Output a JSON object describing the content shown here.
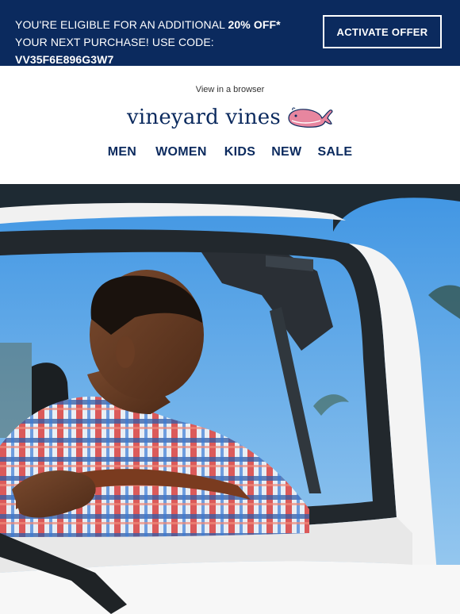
{
  "promo": {
    "text_before": "YOU'RE ELIGIBLE FOR AN ADDITIONAL ",
    "discount": "20% OFF*",
    "text_middle": " YOUR NEXT PURCHASE! USE CODE: ",
    "code": "VV35F6E896G3W7",
    "button_label": "ACTIVATE OFFER"
  },
  "header": {
    "view_in_browser": "View in a browser",
    "brand_logo_text": "vineyard vines",
    "nav": [
      "MEN",
      "WOMEN",
      "KIDS",
      "NEW",
      "SALE"
    ]
  },
  "colors": {
    "navy": "#0b2a5e",
    "whale_pink": "#e7869f",
    "sky": "#4a9be0"
  },
  "icons": {
    "logo": "pink-whale-icon"
  }
}
